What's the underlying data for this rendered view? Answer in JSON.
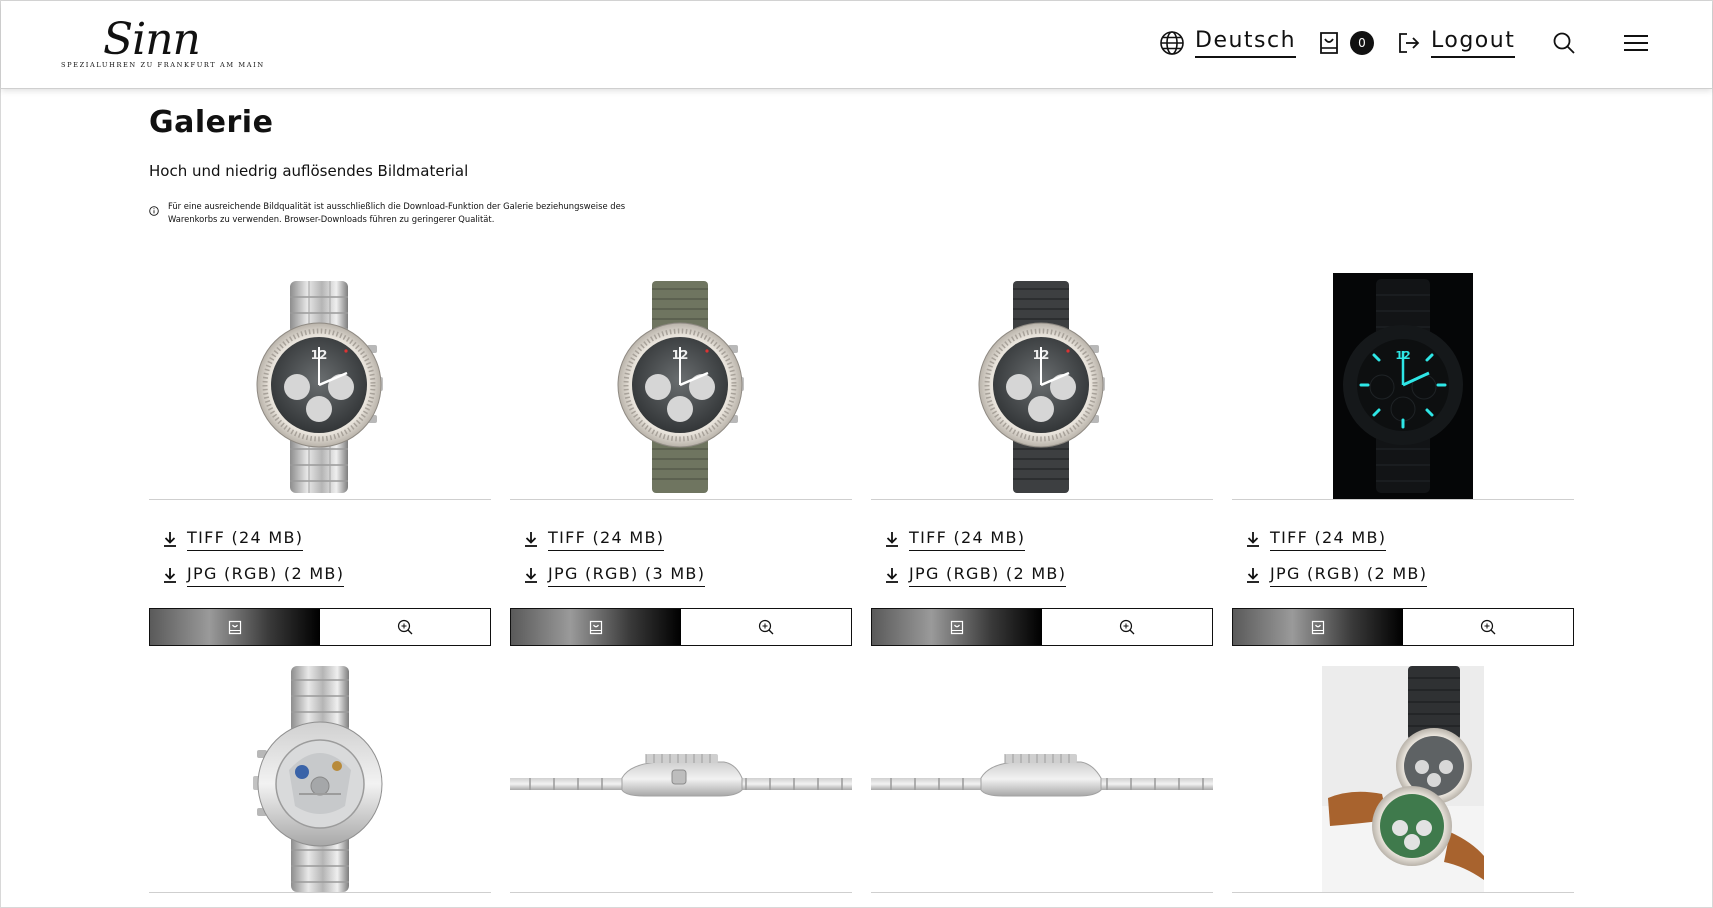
{
  "header": {
    "brand_name": "Sinn",
    "brand_tagline": "SPEZIALUHREN ZU FRANKFURT AM MAIN",
    "language_label": "Deutsch",
    "cart_count": "0",
    "logout_label": "Logout"
  },
  "page": {
    "title": "Galerie",
    "subtitle": "Hoch und niedrig auflösendes Bildmaterial",
    "notice": "Für eine ausreichende Bildqualität ist ausschließlich die Download-Funktion der Galerie beziehungsweise des Warenkorbs zu verwenden. Browser-Downloads führen zu geringerer Qualität."
  },
  "gallery": [
    {
      "tiff_label": "TIFF (24 MB)",
      "jpg_label": "JPG (RGB) (2 MB)",
      "image": "watch-front-steel-bracelet"
    },
    {
      "tiff_label": "TIFF (24 MB)",
      "jpg_label": "JPG (RGB) (3 MB)",
      "image": "watch-front-olive-strap"
    },
    {
      "tiff_label": "TIFF (24 MB)",
      "jpg_label": "JPG (RGB) (2 MB)",
      "image": "watch-front-grey-strap"
    },
    {
      "tiff_label": "TIFF (24 MB)",
      "jpg_label": "JPG (RGB) (2 MB)",
      "image": "watch-luminous-night"
    },
    {
      "image": "watch-caseback-bracelet"
    },
    {
      "image": "watch-side-profile-left"
    },
    {
      "image": "watch-side-profile-right"
    },
    {
      "image": "two-watches-lifestyle"
    }
  ],
  "colors": {
    "accent": "#111111",
    "lume": "#2ee6e6"
  }
}
